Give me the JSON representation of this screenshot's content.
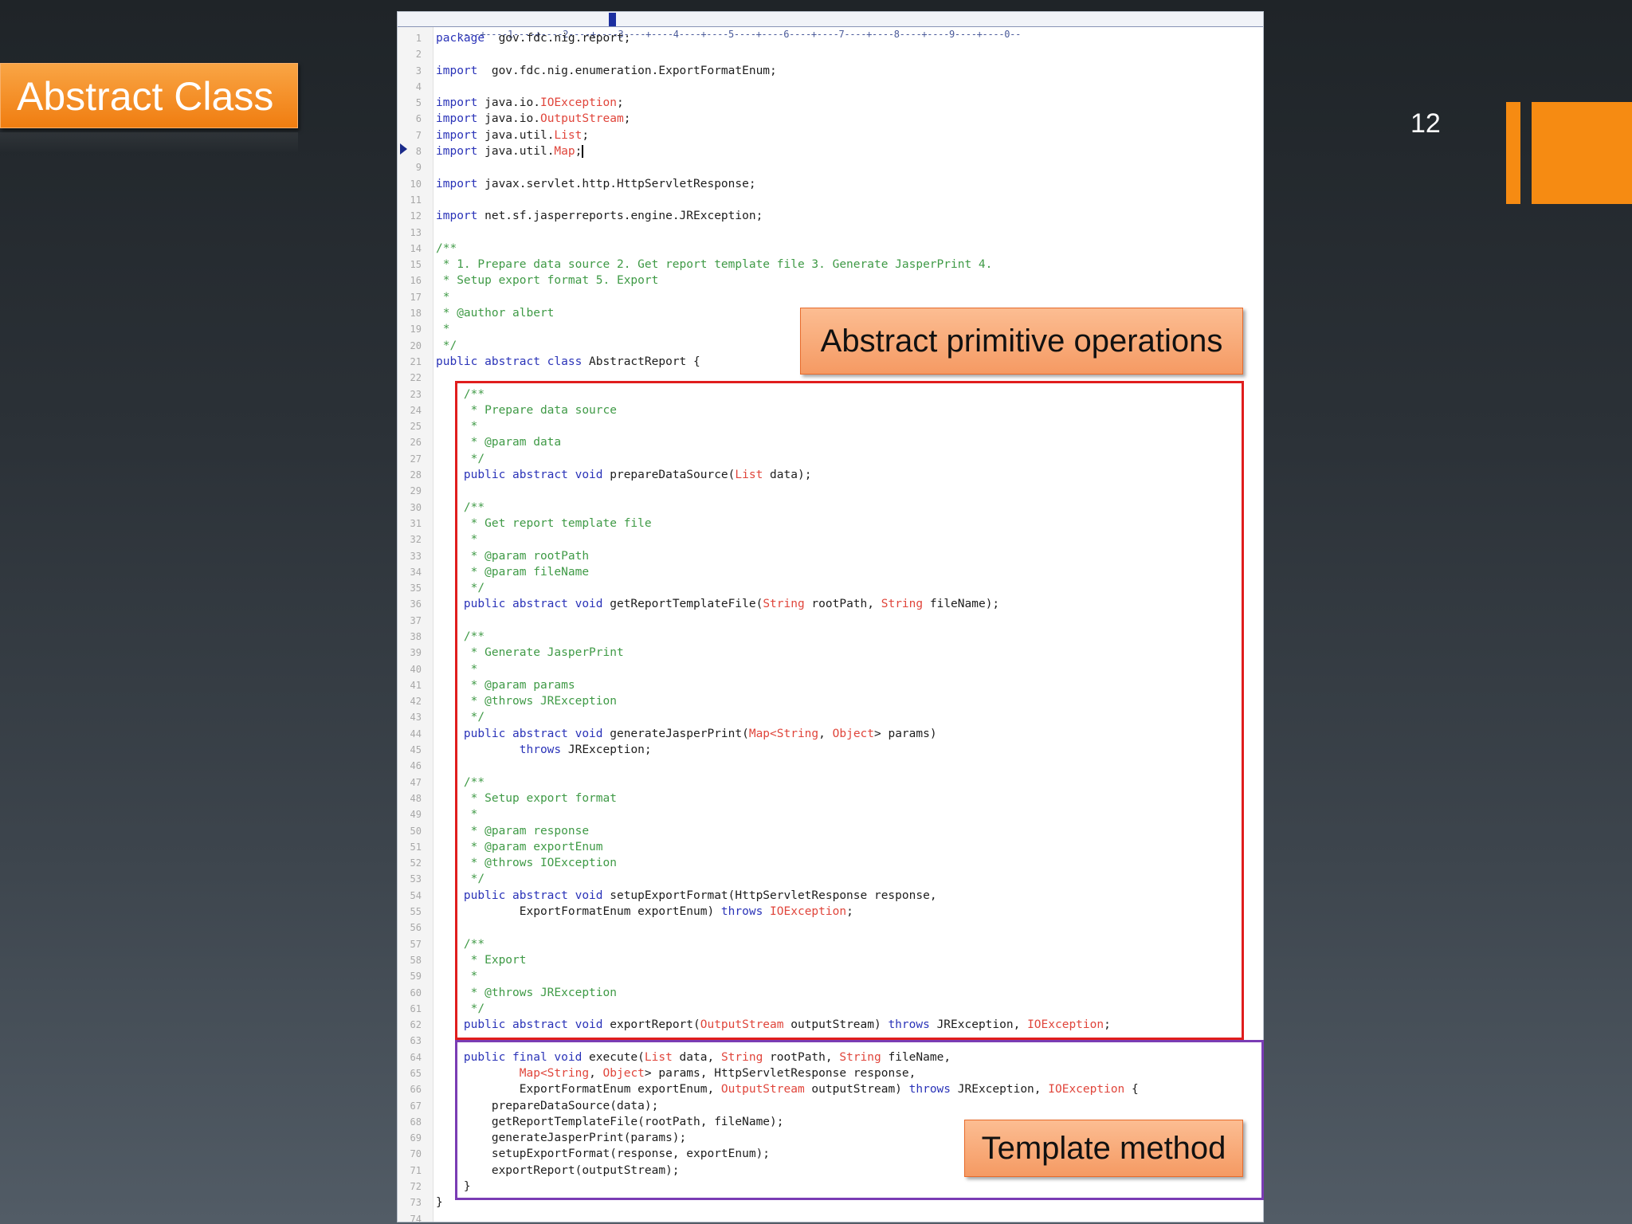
{
  "slide": {
    "title": "Abstract Class",
    "page_number": "12"
  },
  "editor": {
    "ruler": "----+----1----+----2----+----3----+----4----+----5----+----6----+----7----+----8----+----9----+----0--",
    "lines": [
      {
        "n": "1",
        "segs": [
          [
            "kw",
            "package"
          ],
          [
            "",
            "  gov.fdc.nig.report;"
          ]
        ]
      },
      {
        "n": "2",
        "segs": []
      },
      {
        "n": "3",
        "segs": [
          [
            "kw",
            "import"
          ],
          [
            "",
            "  gov.fdc.nig.enumeration.ExportFormatEnum;"
          ]
        ]
      },
      {
        "n": "4",
        "segs": []
      },
      {
        "n": "5",
        "segs": [
          [
            "kw",
            "import"
          ],
          [
            "",
            " java.io."
          ],
          [
            "ty",
            "IOException"
          ],
          [
            "",
            ";"
          ]
        ]
      },
      {
        "n": "6",
        "segs": [
          [
            "kw",
            "import"
          ],
          [
            "",
            " java.io."
          ],
          [
            "ty",
            "OutputStream"
          ],
          [
            "",
            ";"
          ]
        ]
      },
      {
        "n": "7",
        "segs": [
          [
            "kw",
            "import"
          ],
          [
            "",
            " java.util."
          ],
          [
            "ty",
            "List"
          ],
          [
            "",
            ";"
          ]
        ]
      },
      {
        "n": "8",
        "segs": [
          [
            "kw",
            "import"
          ],
          [
            "",
            " java.util."
          ],
          [
            "ty",
            "Map"
          ],
          [
            "",
            ";"
          ]
        ],
        "cursor": true
      },
      {
        "n": "9",
        "segs": []
      },
      {
        "n": "10",
        "segs": [
          [
            "kw",
            "import"
          ],
          [
            "",
            " javax.servlet.http.HttpServletResponse;"
          ]
        ]
      },
      {
        "n": "11",
        "segs": []
      },
      {
        "n": "12",
        "segs": [
          [
            "kw",
            "import"
          ],
          [
            "",
            " net.sf.jasperreports.engine.JRException;"
          ]
        ]
      },
      {
        "n": "13",
        "segs": []
      },
      {
        "n": "14",
        "segs": [
          [
            "cm",
            "/**"
          ]
        ]
      },
      {
        "n": "15",
        "segs": [
          [
            "cm",
            " * 1. Prepare data source 2. Get report template file 3. Generate JasperPrint 4."
          ]
        ]
      },
      {
        "n": "16",
        "segs": [
          [
            "cm",
            " * Setup export format 5. Export"
          ]
        ]
      },
      {
        "n": "17",
        "segs": [
          [
            "cm",
            " *"
          ]
        ]
      },
      {
        "n": "18",
        "segs": [
          [
            "cm",
            " * @author albert"
          ]
        ]
      },
      {
        "n": "19",
        "segs": [
          [
            "cm",
            " *"
          ]
        ]
      },
      {
        "n": "20",
        "segs": [
          [
            "cm",
            " */"
          ]
        ]
      },
      {
        "n": "21",
        "segs": [
          [
            "kw",
            "public abstract class"
          ],
          [
            "",
            " AbstractReport {"
          ]
        ]
      },
      {
        "n": "22",
        "segs": []
      },
      {
        "n": "23",
        "segs": [
          [
            "cm",
            "    /**"
          ]
        ]
      },
      {
        "n": "24",
        "segs": [
          [
            "cm",
            "     * Prepare data source"
          ]
        ]
      },
      {
        "n": "25",
        "segs": [
          [
            "cm",
            "     *"
          ]
        ]
      },
      {
        "n": "26",
        "segs": [
          [
            "cm",
            "     * @param data"
          ]
        ]
      },
      {
        "n": "27",
        "segs": [
          [
            "cm",
            "     */"
          ]
        ]
      },
      {
        "n": "28",
        "segs": [
          [
            "kw",
            "    public abstract void"
          ],
          [
            "",
            " prepareDataSource("
          ],
          [
            "ty",
            "List"
          ],
          [
            "",
            " data);"
          ]
        ]
      },
      {
        "n": "29",
        "segs": []
      },
      {
        "n": "30",
        "segs": [
          [
            "cm",
            "    /**"
          ]
        ]
      },
      {
        "n": "31",
        "segs": [
          [
            "cm",
            "     * Get report template file"
          ]
        ]
      },
      {
        "n": "32",
        "segs": [
          [
            "cm",
            "     *"
          ]
        ]
      },
      {
        "n": "33",
        "segs": [
          [
            "cm",
            "     * @param rootPath"
          ]
        ]
      },
      {
        "n": "34",
        "segs": [
          [
            "cm",
            "     * @param fileName"
          ]
        ]
      },
      {
        "n": "35",
        "segs": [
          [
            "cm",
            "     */"
          ]
        ]
      },
      {
        "n": "36",
        "segs": [
          [
            "kw",
            "    public abstract void"
          ],
          [
            "",
            " getReportTemplateFile("
          ],
          [
            "ty",
            "String"
          ],
          [
            "",
            " rootPath, "
          ],
          [
            "ty",
            "String"
          ],
          [
            "",
            " fileName);"
          ]
        ]
      },
      {
        "n": "37",
        "segs": []
      },
      {
        "n": "38",
        "segs": [
          [
            "cm",
            "    /**"
          ]
        ]
      },
      {
        "n": "39",
        "segs": [
          [
            "cm",
            "     * Generate JasperPrint"
          ]
        ]
      },
      {
        "n": "40",
        "segs": [
          [
            "cm",
            "     *"
          ]
        ]
      },
      {
        "n": "41",
        "segs": [
          [
            "cm",
            "     * @param params"
          ]
        ]
      },
      {
        "n": "42",
        "segs": [
          [
            "cm",
            "     * @throws JRException"
          ]
        ]
      },
      {
        "n": "43",
        "segs": [
          [
            "cm",
            "     */"
          ]
        ]
      },
      {
        "n": "44",
        "segs": [
          [
            "kw",
            "    public abstract void"
          ],
          [
            "",
            " generateJasperPrint("
          ],
          [
            "ty",
            "Map<String"
          ],
          [
            "",
            ", "
          ],
          [
            "ty",
            "Object"
          ],
          [
            "",
            "> params)"
          ]
        ]
      },
      {
        "n": "45",
        "segs": [
          [
            "kw",
            "            throws"
          ],
          [
            "",
            " JRException;"
          ]
        ]
      },
      {
        "n": "46",
        "segs": []
      },
      {
        "n": "47",
        "segs": [
          [
            "cm",
            "    /**"
          ]
        ]
      },
      {
        "n": "48",
        "segs": [
          [
            "cm",
            "     * Setup export format"
          ]
        ]
      },
      {
        "n": "49",
        "segs": [
          [
            "cm",
            "     *"
          ]
        ]
      },
      {
        "n": "50",
        "segs": [
          [
            "cm",
            "     * @param response"
          ]
        ]
      },
      {
        "n": "51",
        "segs": [
          [
            "cm",
            "     * @param exportEnum"
          ]
        ]
      },
      {
        "n": "52",
        "segs": [
          [
            "cm",
            "     * @throws IOException"
          ]
        ]
      },
      {
        "n": "53",
        "segs": [
          [
            "cm",
            "     */"
          ]
        ]
      },
      {
        "n": "54",
        "segs": [
          [
            "kw",
            "    public abstract void"
          ],
          [
            "",
            " setupExportFormat(HttpServletResponse response,"
          ]
        ]
      },
      {
        "n": "55",
        "segs": [
          [
            "",
            "            ExportFormatEnum exportEnum) "
          ],
          [
            "kw",
            "throws"
          ],
          [
            "ty",
            " IOException"
          ],
          [
            "",
            ";"
          ]
        ]
      },
      {
        "n": "56",
        "segs": []
      },
      {
        "n": "57",
        "segs": [
          [
            "cm",
            "    /**"
          ]
        ]
      },
      {
        "n": "58",
        "segs": [
          [
            "cm",
            "     * Export"
          ]
        ]
      },
      {
        "n": "59",
        "segs": [
          [
            "cm",
            "     *"
          ]
        ]
      },
      {
        "n": "60",
        "segs": [
          [
            "cm",
            "     * @throws JRException"
          ]
        ]
      },
      {
        "n": "61",
        "segs": [
          [
            "cm",
            "     */"
          ]
        ]
      },
      {
        "n": "62",
        "segs": [
          [
            "kw",
            "    public abstract void"
          ],
          [
            "",
            " exportReport("
          ],
          [
            "ty",
            "OutputStream"
          ],
          [
            "",
            " outputStream) "
          ],
          [
            "kw",
            "throws"
          ],
          [
            "",
            " JRException, "
          ],
          [
            "ty",
            "IOException"
          ],
          [
            "",
            ";"
          ]
        ]
      },
      {
        "n": "63",
        "segs": []
      },
      {
        "n": "64",
        "segs": [
          [
            "kw",
            "    public final void"
          ],
          [
            "",
            " execute("
          ],
          [
            "ty",
            "List"
          ],
          [
            "",
            " data, "
          ],
          [
            "ty",
            "String"
          ],
          [
            "",
            " rootPath, "
          ],
          [
            "ty",
            "String"
          ],
          [
            "",
            " fileName,"
          ]
        ]
      },
      {
        "n": "65",
        "segs": [
          [
            "ty",
            "            Map<String"
          ],
          [
            "",
            ", "
          ],
          [
            "ty",
            "Object"
          ],
          [
            "",
            "> params, HttpServletResponse response,"
          ]
        ]
      },
      {
        "n": "66",
        "segs": [
          [
            "",
            "            ExportFormatEnum exportEnum, "
          ],
          [
            "ty",
            "OutputStream"
          ],
          [
            "",
            " outputStream) "
          ],
          [
            "kw",
            "throws"
          ],
          [
            "",
            " JRException, "
          ],
          [
            "ty",
            "IOException"
          ],
          [
            "",
            " {"
          ]
        ]
      },
      {
        "n": "67",
        "segs": [
          [
            "",
            "        prepareDataSource(data);"
          ]
        ]
      },
      {
        "n": "68",
        "segs": [
          [
            "",
            "        getReportTemplateFile(rootPath, fileName);"
          ]
        ]
      },
      {
        "n": "69",
        "segs": [
          [
            "",
            "        generateJasperPrint(params);"
          ]
        ]
      },
      {
        "n": "70",
        "segs": [
          [
            "",
            "        setupExportFormat(response, exportEnum);"
          ]
        ]
      },
      {
        "n": "71",
        "segs": [
          [
            "",
            "        exportReport(outputStream);"
          ]
        ]
      },
      {
        "n": "72",
        "segs": [
          [
            "",
            "    }"
          ]
        ]
      },
      {
        "n": "73",
        "segs": [
          [
            "",
            "}"
          ]
        ]
      },
      {
        "n": "74",
        "segs": []
      }
    ]
  },
  "callouts": {
    "abstract_ops": "Abstract primitive operations",
    "template_method": "Template method"
  },
  "colors": {
    "accent_orange": "#f68b12",
    "keyword": "#2a33b8",
    "comment": "#3f9a46",
    "type": "#e0453b",
    "highlight_red": "#e01d1d",
    "highlight_purple": "#7a3cb4"
  }
}
